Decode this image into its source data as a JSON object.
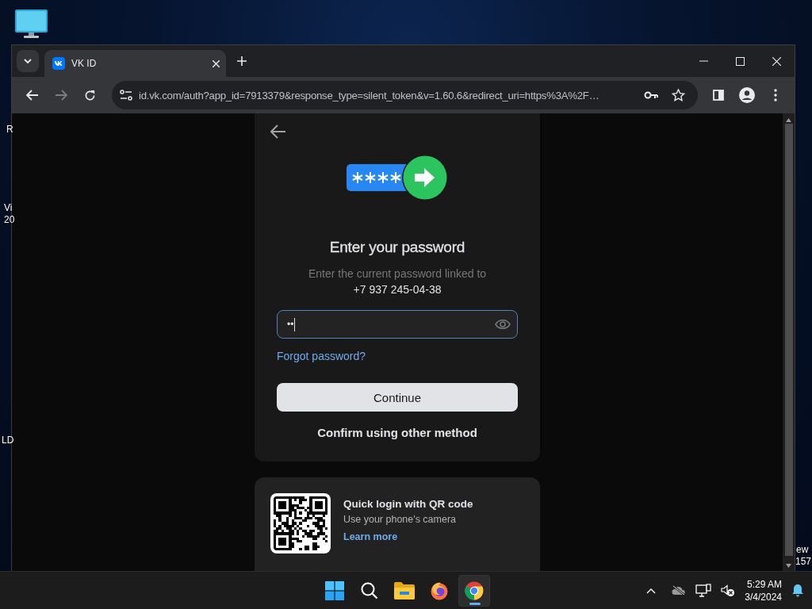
{
  "desktop": {
    "labels": [
      "R",
      "Vi",
      "20",
      "LD",
      "ew",
      "157"
    ]
  },
  "browser": {
    "tabs": [
      {
        "title": "VK ID",
        "selected": true
      }
    ],
    "address": "id.vk.com/auth?app_id=7913379&response_type=silent_token&v=1.60.6&redirect_uri=https%3A%2F…"
  },
  "login": {
    "title": "Enter your password",
    "subtitle": "Enter the current password linked to",
    "phone": "+7 937 245-04-38",
    "password": {
      "value": "••"
    },
    "forgot_link": "Forgot password?",
    "continue_button": "Continue",
    "other_method": "Confirm using other method"
  },
  "qr": {
    "title": "Quick login with QR code",
    "subtitle": "Use your phone's camera",
    "link": "Learn more"
  },
  "taskbar": {
    "apps": [
      {
        "kind": "start",
        "selected": false
      },
      {
        "kind": "search",
        "selected": false
      },
      {
        "kind": "files",
        "selected": false
      },
      {
        "kind": "firefox",
        "selected": false
      },
      {
        "kind": "chrome",
        "selected": true
      }
    ],
    "time": "5:29 AM",
    "date": "3/4/2024"
  }
}
